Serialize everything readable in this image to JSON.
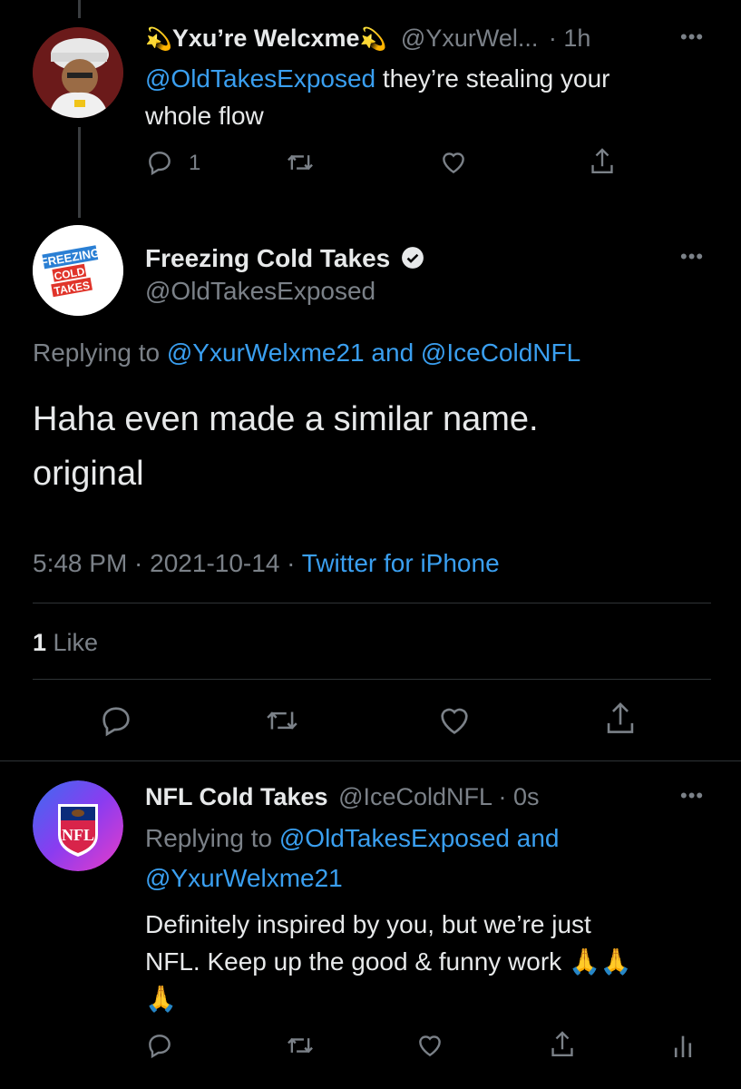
{
  "tweet1": {
    "display_name": "Yxu’re Welcxme",
    "handle": "@YxurWel...",
    "time": "· 1h",
    "mention": "@OldTakesExposed",
    "text_line1": " they’re stealing your",
    "text_line2": "whole flow",
    "reply_count": "1",
    "comet_emoji": "💫"
  },
  "main": {
    "display_name": "Freezing Cold Takes",
    "handle": "@OldTakesExposed",
    "replying_prefix": "Replying to ",
    "replying_user1": "@YxurWelxme21",
    "replying_and": " and ",
    "replying_user2": "@IceColdNFL",
    "text_line1": "Haha even made a similar name.",
    "text_line2": "original",
    "timestamp": "5:48 PM · 2021-10-14 · ",
    "source": "Twitter for iPhone",
    "likes_count": "1",
    "likes_label": " Like",
    "avatar_text": [
      "FREEZING",
      "COLD",
      "TAKES"
    ]
  },
  "tweet3": {
    "display_name": "NFL Cold Takes",
    "handle": "@IceColdNFL",
    "time": "· 0s",
    "replying_prefix": "Replying to ",
    "replying_user1": "@OldTakesExposed",
    "replying_and": " and",
    "replying_user2": "@YxurWelxme21",
    "text_line1": "Definitely inspired by you, but we’re just",
    "text_line2": "NFL. Keep up the good & funny work ",
    "emoji": "🙏",
    "avatar_text": "NFL"
  },
  "colors": {
    "background": "#000000",
    "link": "#3a9ff0",
    "muted": "#7b8188",
    "text": "#e7e9ea"
  }
}
